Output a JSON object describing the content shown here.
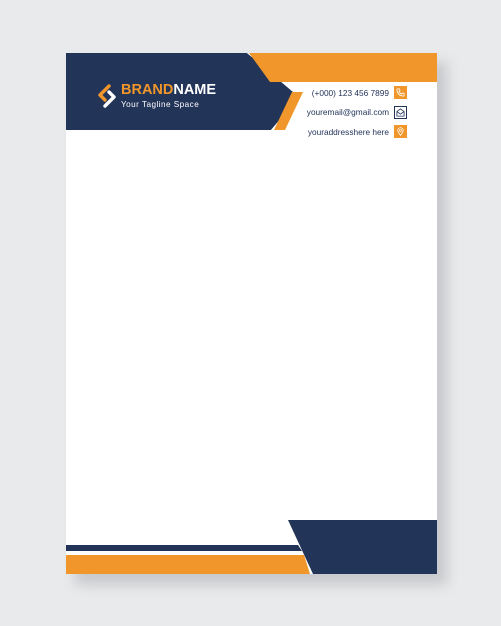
{
  "letterhead": {
    "brand": {
      "name_part1": "BRAND",
      "name_part2": "NAME",
      "tagline": "Your Tagline Space"
    },
    "contacts": [
      {
        "text": "(+000) 123 456 7899",
        "icon": "phone-icon"
      },
      {
        "text": "youremail@gmail.com",
        "icon": "envelope-icon"
      },
      {
        "text": "youraddresshere here",
        "icon": "location-pin-icon"
      }
    ]
  },
  "colors": {
    "navy": "#233459",
    "orange": "#f0962b",
    "paper": "#ffffff",
    "background": "#e9eaec"
  }
}
